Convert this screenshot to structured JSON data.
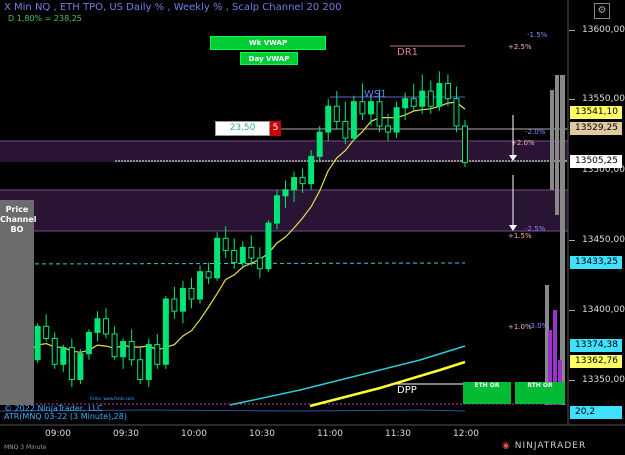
{
  "header": {
    "title": "X Min NQ , ETH TPO, US Daily % , Weekly % , Scalp Channel 20  200",
    "subtitle": "D  1,80% = 238,25"
  },
  "buttons": {
    "wk_vwap": "Wk VWAP",
    "day_vwap": "Day VWAP"
  },
  "quantity": {
    "value": "23,50",
    "badge": "5"
  },
  "level_labels": {
    "dr1": "DR1",
    "ws1": "WS1",
    "dpp": "DPP"
  },
  "percent_labels": {
    "neg_1_5": "-1.5%",
    "pos_2_5": "+2.5%",
    "neg_2_0": "-2.0%",
    "pos_2_0": "+2.0%",
    "neg_2_5": "-2.5%",
    "pos_1_5": "+1.5%",
    "pos_1_0": "+1.0%",
    "neg_3_0": "-3.0%"
  },
  "y_axis": {
    "ticks": [
      "13600,00",
      "13550,00",
      "13500,00",
      "13450,00",
      "13400,00",
      "13350,00"
    ]
  },
  "price_boxes": {
    "top": "13541,10",
    "wbox": "13529,25",
    "last": "13505,25",
    "cyan": "13433,25",
    "mid": "13374,38",
    "yellow": "13362,76",
    "atr": "20,2"
  },
  "x_axis": {
    "ticks": [
      "09:00",
      "09:30",
      "10:00",
      "10:30",
      "11:00",
      "11:30",
      "12:00"
    ]
  },
  "side_panel": {
    "label": "Price Channel BO"
  },
  "tags": {
    "eth_or": "ETH OR",
    "rth_or": "RTH OR"
  },
  "footer": {
    "copyright": "© 2022 NinjaTrader, LLC",
    "atr": "ATR(MNQ 03-22 (3 Minute),28)",
    "instrument": "MNQ 3 Minute",
    "brand": "NINJATRADER",
    "small_text": "Fonts: www.fonts.com"
  },
  "colors": {
    "up_candle": "#00e676",
    "down_candle": "#000000",
    "sma": "#e8e04a",
    "vwap_cyan": "#28d0d8",
    "band_purple": "#3a1a4a",
    "box_yellow": "#ffff66",
    "box_tan": "#e0c8a0",
    "box_cyan": "#40e0ff"
  },
  "chart_data": {
    "type": "candlestick",
    "x": [
      "09:00",
      "09:30",
      "10:00",
      "10:30",
      "11:00",
      "11:30",
      "12:00"
    ],
    "ylim": [
      13335,
      13615
    ],
    "candles": [
      [
        13380,
        13392,
        13370,
        13388
      ],
      [
        13388,
        13398,
        13382,
        13385
      ],
      [
        13385,
        13395,
        13375,
        13378
      ],
      [
        13378,
        13402,
        13376,
        13400
      ],
      [
        13400,
        13408,
        13390,
        13392
      ],
      [
        13392,
        13396,
        13372,
        13375
      ],
      [
        13375,
        13388,
        13370,
        13386
      ],
      [
        13386,
        13392,
        13360,
        13365
      ],
      [
        13365,
        13385,
        13362,
        13382
      ],
      [
        13382,
        13398,
        13378,
        13396
      ],
      [
        13396,
        13410,
        13390,
        13405
      ],
      [
        13405,
        13412,
        13392,
        13395
      ],
      [
        13395,
        13400,
        13378,
        13380
      ],
      [
        13380,
        13392,
        13372,
        13390
      ],
      [
        13390,
        13398,
        13374,
        13378
      ],
      [
        13378,
        13386,
        13362,
        13365
      ],
      [
        13365,
        13392,
        13360,
        13388
      ],
      [
        13388,
        13395,
        13372,
        13375
      ],
      [
        13375,
        13420,
        13372,
        13418
      ],
      [
        13418,
        13426,
        13405,
        13410
      ],
      [
        13410,
        13430,
        13402,
        13425
      ],
      [
        13425,
        13432,
        13412,
        13418
      ],
      [
        13418,
        13440,
        13415,
        13436
      ],
      [
        13436,
        13442,
        13428,
        13432
      ],
      [
        13432,
        13462,
        13430,
        13458
      ],
      [
        13458,
        13466,
        13445,
        13450
      ],
      [
        13450,
        13458,
        13438,
        13442
      ],
      [
        13442,
        13456,
        13438,
        13452
      ],
      [
        13452,
        13460,
        13440,
        13445
      ],
      [
        13445,
        13452,
        13432,
        13438
      ],
      [
        13438,
        13470,
        13436,
        13468
      ],
      [
        13468,
        13490,
        13464,
        13486
      ],
      [
        13486,
        13496,
        13478,
        13490
      ],
      [
        13490,
        13502,
        13482,
        13498
      ],
      [
        13498,
        13504,
        13488,
        13494
      ],
      [
        13494,
        13516,
        13490,
        13512
      ],
      [
        13512,
        13532,
        13508,
        13528
      ],
      [
        13528,
        13550,
        13522,
        13545
      ],
      [
        13545,
        13555,
        13530,
        13535
      ],
      [
        13535,
        13548,
        13520,
        13524
      ],
      [
        13524,
        13552,
        13522,
        13548
      ],
      [
        13548,
        13560,
        13536,
        13540
      ],
      [
        13540,
        13552,
        13532,
        13548
      ],
      [
        13548,
        13556,
        13528,
        13532
      ],
      [
        13532,
        13540,
        13522,
        13528
      ],
      [
        13528,
        13548,
        13524,
        13544
      ],
      [
        13544,
        13554,
        13536,
        13550
      ],
      [
        13550,
        13560,
        13542,
        13545
      ],
      [
        13545,
        13566,
        13540,
        13555
      ],
      [
        13555,
        13562,
        13540,
        13545
      ],
      [
        13545,
        13568,
        13542,
        13560
      ],
      [
        13560,
        13566,
        13545,
        13550
      ],
      [
        13550,
        13558,
        13528,
        13532
      ],
      [
        13532,
        13536,
        13505,
        13508
      ]
    ]
  }
}
